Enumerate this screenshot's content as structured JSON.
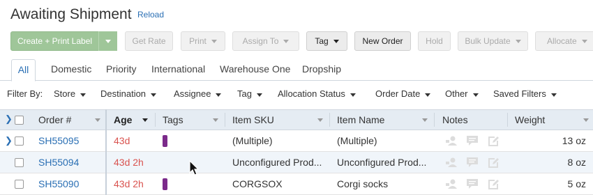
{
  "page": {
    "title": "Awaiting Shipment",
    "reload_label": "Reload"
  },
  "toolbar": {
    "create_label": "Create + Print Label",
    "get_rate": "Get Rate",
    "print": "Print",
    "assign_to": "Assign To",
    "tag": "Tag",
    "new_order": "New Order",
    "hold": "Hold",
    "bulk_update": "Bulk Update",
    "allocate": "Allocate"
  },
  "tabs": [
    "All",
    "Domestic",
    "Priority",
    "International",
    "Warehouse One",
    "Dropship"
  ],
  "filters": {
    "label": "Filter By:",
    "items": [
      "Store",
      "Destination",
      "Assignee",
      "Tag",
      "Allocation Status",
      "Order Date",
      "Other",
      "Saved Filters"
    ]
  },
  "table": {
    "columns": [
      "Order #",
      "Age",
      "Tags",
      "Item SKU",
      "Item Name",
      "Notes",
      "Weight"
    ],
    "rows": [
      {
        "order": "SH55095",
        "age": "43d",
        "has_tag": true,
        "sku": "(Multiple)",
        "name": "(Multiple)",
        "weight": "13 oz",
        "expandable": true
      },
      {
        "order": "SH55094",
        "age": "43d 2h",
        "has_tag": false,
        "sku": "Unconfigured Prod...",
        "name": "Unconfigured Prod...",
        "weight": "8 oz",
        "expandable": false
      },
      {
        "order": "SH55090",
        "age": "43d 2h",
        "has_tag": true,
        "sku": "CORGSOX",
        "name": "Corgi socks",
        "weight": "5 oz",
        "expandable": false
      }
    ]
  },
  "colors": {
    "link": "#2a6fb4",
    "age": "#d9534f",
    "tag": "#7b2a8a",
    "primary_button": "#9fc699",
    "header_bg": "#e5ecf3"
  }
}
